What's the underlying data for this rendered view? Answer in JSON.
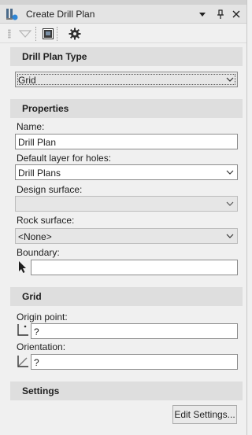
{
  "window": {
    "title": "Create Drill Plan",
    "app_icon": "drill-plan-icon",
    "pin_icon": "pin-icon",
    "dropdown_icon": "window-menu-icon",
    "close_icon": "close-icon"
  },
  "toolbar": {
    "icons": [
      "toolbar-grip-icon",
      "triangle-collapse-icon",
      "window-panel-icon",
      "gear-icon"
    ]
  },
  "sections": {
    "drill_plan_type": {
      "header": "Drill Plan Type",
      "selected": "Grid"
    },
    "properties": {
      "header": "Properties",
      "name_label": "Name:",
      "name_value": "Drill Plan",
      "layer_label": "Default layer for holes:",
      "layer_value": "Drill Plans",
      "design_surface_label": "Design surface:",
      "design_surface_value": "",
      "rock_surface_label": "Rock surface:",
      "rock_surface_value": "<None>",
      "boundary_label": "Boundary:",
      "boundary_value": ""
    },
    "grid": {
      "header": "Grid",
      "origin_label": "Origin point:",
      "origin_value": "?",
      "orientation_label": "Orientation:",
      "orientation_value": "?"
    },
    "settings": {
      "header": "Settings",
      "edit_button": "Edit Settings..."
    }
  },
  "colors": {
    "section_bg": "#dedede",
    "panel_bg": "#f0f0f0",
    "field_border": "#8c8c8c"
  }
}
